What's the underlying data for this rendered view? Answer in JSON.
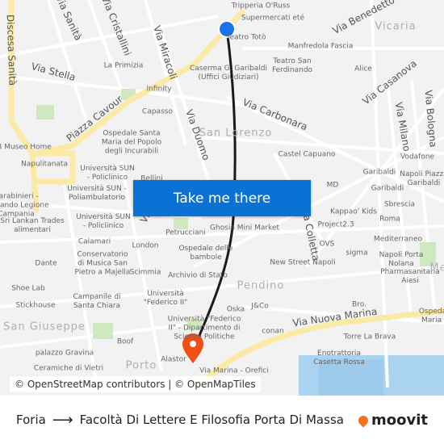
{
  "map": {
    "labels": [
      "Tripperia O'Russ",
      "Supermercati eté",
      "Teatro Totò",
      "Manfredola Fascia",
      "La Primizia",
      "Caserma G. Garibaldi\n(Uffici Giudiziari)",
      "Teatro San\nFerdinando",
      "Alice",
      "Infinity",
      "Capasso",
      "Ospedale Santa\nMaria del Popolo\ndegli Incurabili",
      "B Museo Home",
      "Napulitanata",
      "Università SUN\n- Policlinico",
      "Castel Capuano",
      "Vodafone",
      "Garibaldi",
      "Napoli Piazza\nGaribaldi",
      "MD",
      "Garibaldi",
      "Sbrescia",
      "Kappao' Kids",
      "Roma",
      "Project2.3",
      "Ghosia Mini Market",
      "Petrucciani",
      "Calamari",
      "London",
      "Sri Lankan Trades\nalimentari",
      "Università SUN\n- Policlinico",
      "Conservatorio\ndi Musica San\nPietro a Majella",
      "Dante",
      "Ospedale delle\nbambole",
      "Scimmia",
      "Archivio di Stato",
      "OVS",
      "Mediterraneo",
      "sigma",
      "New Street Napoli",
      "Napoli Porta\nNolana",
      "Pharmasanitaria\nAiesi",
      "Shoe Lab",
      "Stickhouse",
      "Campanile di\nSanta Chiara",
      "Università\n\"Federico II\"",
      "Oska",
      "J&Co",
      "Bro.",
      "Università \"Federico\nII\" - Dipartimento di\nScienze Politiche",
      "Boof",
      "conan",
      "Torre La Brava",
      "palazzo Gravina",
      "Alastor",
      "Enotrattoria\nCasetta Rossa",
      "Ceramiche di Vietri",
      "Via Marina - Orefici",
      "Carabinieri -\nComando Legione\nCampania",
      "Università SUN -\nPoliambulatorio",
      "Bellini",
      "Ospedale\nMaria di"
    ],
    "streets": [
      "Via Sanità",
      "Via Cristallini",
      "Via Miracoli",
      "Via Stella",
      "Piazza Cavour",
      "Via Duomo",
      "Via Carbonara",
      "Via Benedetto",
      "Via Casanova",
      "Via Milano",
      "Via Bologna",
      "Via Colletta",
      "Via Nuova Marina",
      "Discesa Sanità",
      "Via"
    ],
    "districts": [
      "Vicaria",
      "San Lorenzo",
      "Pendino",
      "San Giuseppe",
      "Porto",
      "Me"
    ],
    "attribution": "© OpenStreetMap contributors | © OpenMapTiles",
    "route_color": "#1a1a1a",
    "origin_color": "#1a73e8",
    "destination_color": "#f04e12"
  },
  "cta": {
    "label": "Take me there"
  },
  "footer": {
    "from": "Foria",
    "to": "Facoltà Di Lettere E Filosofia Porta Di Massa",
    "brand": "moovit"
  }
}
